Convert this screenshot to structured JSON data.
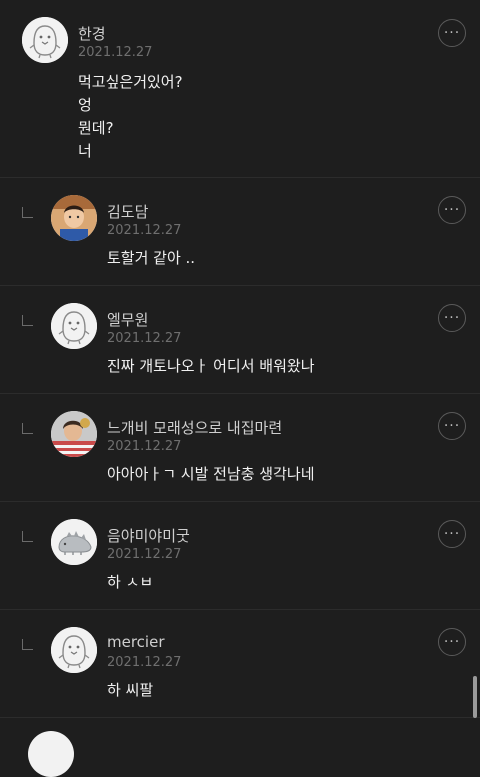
{
  "comments": [
    {
      "author": "한경",
      "date": "2021.12.27",
      "lines": [
        "먹고싶은거있어?",
        "엉",
        "뭔데?",
        "너"
      ],
      "avatar": "penguin-icon",
      "is_reply": false
    },
    {
      "author": "김도담",
      "date": "2021.12.27",
      "lines": [
        "토할거 같아 .."
      ],
      "avatar": "child-photo",
      "is_reply": true
    },
    {
      "author": "엘무원",
      "date": "2021.12.27",
      "lines": [
        "진짜 개토나오ㅏ 어디서 배워왔나"
      ],
      "avatar": "penguin-icon",
      "is_reply": true
    },
    {
      "author": "느개비 모래성으로 내집마련",
      "date": "2021.12.27",
      "lines": [
        "아아아ㅏㄱ 시발 전남충 생각나네"
      ],
      "avatar": "person-photo",
      "is_reply": true
    },
    {
      "author": "음야미야미굿",
      "date": "2021.12.27",
      "lines": [
        "하 ㅅㅂ"
      ],
      "avatar": "dinosaur-icon",
      "is_reply": true
    },
    {
      "author": "mercier",
      "date": "2021.12.27",
      "lines": [
        "하 씨팔"
      ],
      "avatar": "penguin-icon",
      "is_reply": true
    }
  ],
  "more_label": "···",
  "colors": {
    "background": "#1e1e1e",
    "divider": "#2c2c2c",
    "text": "#f0f0f0",
    "muted": "#6f6f6f"
  }
}
